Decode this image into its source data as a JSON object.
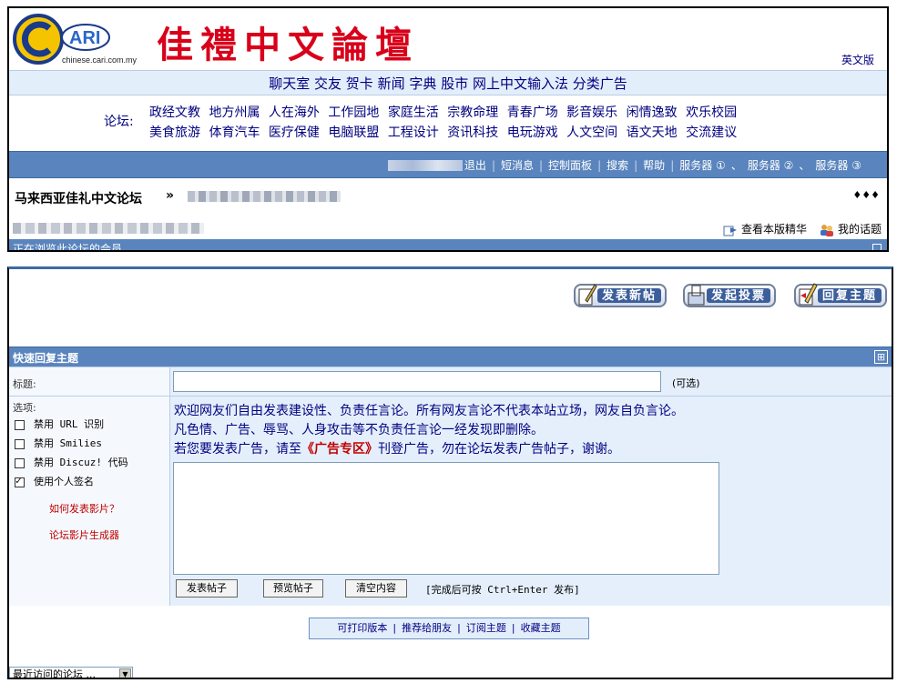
{
  "header": {
    "logo_text": "ARI",
    "logo_url": "chinese.cari.com.my",
    "site_title": "佳禮中文論壇",
    "english_link": "英文版"
  },
  "services": [
    "聊天室",
    "交友",
    "贺卡",
    "新闻",
    "字典",
    "股市",
    "网上中文输入法",
    "分类广告"
  ],
  "forums": {
    "label": "论坛:",
    "row1": [
      "政经文教",
      "地方州属",
      "人在海外",
      "工作园地",
      "家庭生活",
      "宗教命理",
      "青春广场",
      "影音娱乐",
      "闲情逸致",
      "欢乐校园"
    ],
    "row2": [
      "美食旅游",
      "体育汽车",
      "医疗保健",
      "电脑联盟",
      "工程设计",
      "资讯科技",
      "电玩游戏",
      "人文空间",
      "语文天地",
      "交流建议"
    ]
  },
  "nav": {
    "logout": "退出",
    "messages": "短消息",
    "control_panel": "控制面板",
    "search": "搜索",
    "help": "帮助",
    "server1": "服务器 ①",
    "sep_comma": "、",
    "server2": "服务器 ②",
    "server3": "服务器 ③"
  },
  "breadcrumb": {
    "home": "马来西亚佳礼中文论坛",
    "separator": "»",
    "more": "♦♦♦"
  },
  "info": {
    "digest": "查看本版精华",
    "my_topics": "我的话题"
  },
  "online_bar": {
    "text": "正在浏览此论坛的会员"
  },
  "actions": {
    "new_post": "发表新帖",
    "new_poll": "发起投票",
    "reply": "回复主题"
  },
  "quick_reply": {
    "title": "快速回复主题",
    "collapse_symbol": "⊞",
    "subject_label": "标题:",
    "subject_value": "",
    "optional": "(可选)",
    "options_label": "选项:",
    "options": [
      {
        "label": "禁用 URL 识别",
        "checked": false
      },
      {
        "label": "禁用 Smilies",
        "checked": false
      },
      {
        "label": "禁用 Discuz! 代码",
        "checked": false
      },
      {
        "label": "使用个人签名",
        "checked": true
      }
    ],
    "help_video": "如何发表影片？",
    "video_generator": "论坛影片生成器",
    "notice_line1": "欢迎网友们自由发表建设性、负责任言论。所有网友言论不代表本站立场，网友自负言论。",
    "notice_line2": "凡色情、广告、辱骂、人身攻击等不负责任言论一经发现即删除。",
    "notice_line3_pre": "若您要发表广告，请至",
    "notice_line3_link": "《广告专区》",
    "notice_line3_post": "刊登广告，勿在论坛发表广告帖子，谢谢。",
    "message_value": "",
    "submit": "发表帖子",
    "preview": "预览帖子",
    "clear": "清空内容",
    "hint": "[完成后可按 Ctrl+Enter 发布]"
  },
  "footer": {
    "printable": "可打印版本",
    "recommend": "推荐给朋友",
    "subscribe": "订阅主题",
    "favorite": "收藏主题",
    "recent_forums": "最近访问的论坛 ..."
  },
  "colors": {
    "nav_blue": "#5a84bd",
    "light_blue": "#e3eefb",
    "link_navy": "#000080",
    "title_red": "#d8001a"
  }
}
